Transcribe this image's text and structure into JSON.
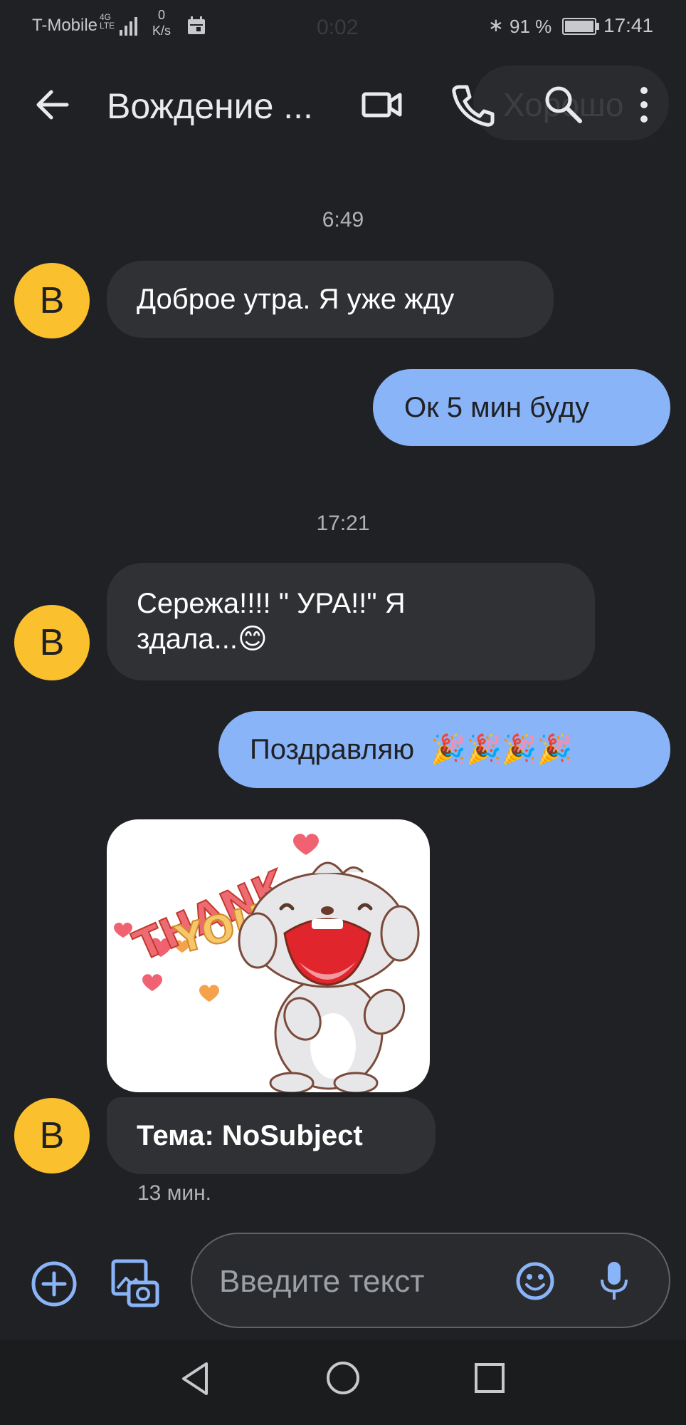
{
  "status_bar": {
    "carrier": "T-Mobile",
    "network": "4G",
    "network_sub": "LTE",
    "speed_value": "0",
    "speed_unit": "K/s",
    "timer": "0:02",
    "battery_percent": "91 %",
    "battery_level": 0.91,
    "time": "17:41"
  },
  "app_bar": {
    "title": "Вождение ...",
    "ghost_text": "Хорошо"
  },
  "messages": [
    {
      "type": "timestamp",
      "text": "6:49"
    },
    {
      "type": "incoming",
      "avatar_letter": "B",
      "text": "Доброе утра. Я уже жду"
    },
    {
      "type": "outgoing",
      "text": "Ок 5 мин буду"
    },
    {
      "type": "timestamp",
      "text": "17:21"
    },
    {
      "type": "incoming",
      "avatar_letter": "B",
      "line1": "Сережа!!!! \" УРА!!\" Я",
      "line2": "здала...",
      "emoji": "😊"
    },
    {
      "type": "outgoing",
      "text": "Поздравляю",
      "emoji": "🎉🎉🎉🎉"
    },
    {
      "type": "sticker",
      "sticker_text": "THANK YOU"
    },
    {
      "type": "incoming",
      "avatar_letter": "B",
      "subject": "Тема: NoSubject",
      "meta": "13 мин."
    }
  ],
  "compose": {
    "placeholder": "Введите текст"
  },
  "colors": {
    "background": "#202124",
    "incoming_bubble": "#303134",
    "outgoing_bubble": "#8ab4f8",
    "avatar": "#fbc02d",
    "accent": "#8ab4f8"
  },
  "icons": [
    "back-arrow-icon",
    "video-call-icon",
    "phone-icon",
    "search-icon",
    "more-vert-icon",
    "add-icon",
    "gallery-icon",
    "emoji-icon",
    "mic-icon",
    "nav-back-icon",
    "nav-home-icon",
    "nav-recents-icon"
  ]
}
